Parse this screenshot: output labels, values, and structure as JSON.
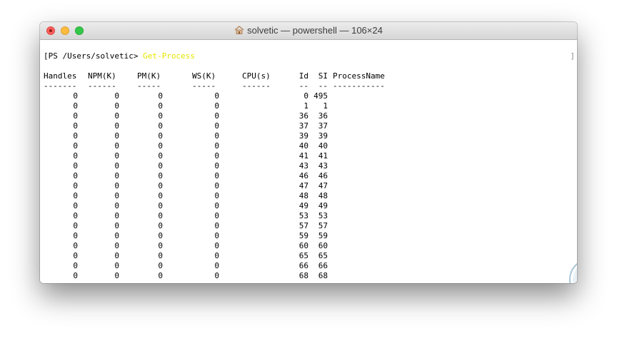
{
  "window": {
    "title": "solvetic — powershell — 106×24",
    "title_icon": "home-icon"
  },
  "terminal": {
    "prompt": "[PS /Users/solvetic> ",
    "command": "Get-Process",
    "right_bracket": "]",
    "command_color": "#e6e600",
    "headers": {
      "handles": "Handles",
      "npm": "NPM(K)",
      "pm": "PM(K)",
      "ws": "WS(K)",
      "cpu": "CPU(s)",
      "id": "Id",
      "si": "SI",
      "pn": "ProcessName"
    },
    "separators": {
      "handles": "-------",
      "npm": "------",
      "pm": "-----",
      "ws": "-----",
      "cpu": "------",
      "id": "--",
      "si": "--",
      "pn": "-----------"
    },
    "rows": [
      {
        "handles": "0",
        "npm": "0",
        "pm": "0",
        "ws": "0",
        "cpu": "",
        "id": "0",
        "si": "495",
        "pn": ""
      },
      {
        "handles": "0",
        "npm": "0",
        "pm": "0",
        "ws": "0",
        "cpu": "",
        "id": "1",
        "si": "1",
        "pn": ""
      },
      {
        "handles": "0",
        "npm": "0",
        "pm": "0",
        "ws": "0",
        "cpu": "",
        "id": "36",
        "si": "36",
        "pn": ""
      },
      {
        "handles": "0",
        "npm": "0",
        "pm": "0",
        "ws": "0",
        "cpu": "",
        "id": "37",
        "si": "37",
        "pn": ""
      },
      {
        "handles": "0",
        "npm": "0",
        "pm": "0",
        "ws": "0",
        "cpu": "",
        "id": "39",
        "si": "39",
        "pn": ""
      },
      {
        "handles": "0",
        "npm": "0",
        "pm": "0",
        "ws": "0",
        "cpu": "",
        "id": "40",
        "si": "40",
        "pn": ""
      },
      {
        "handles": "0",
        "npm": "0",
        "pm": "0",
        "ws": "0",
        "cpu": "",
        "id": "41",
        "si": "41",
        "pn": ""
      },
      {
        "handles": "0",
        "npm": "0",
        "pm": "0",
        "ws": "0",
        "cpu": "",
        "id": "43",
        "si": "43",
        "pn": ""
      },
      {
        "handles": "0",
        "npm": "0",
        "pm": "0",
        "ws": "0",
        "cpu": "",
        "id": "46",
        "si": "46",
        "pn": ""
      },
      {
        "handles": "0",
        "npm": "0",
        "pm": "0",
        "ws": "0",
        "cpu": "",
        "id": "47",
        "si": "47",
        "pn": ""
      },
      {
        "handles": "0",
        "npm": "0",
        "pm": "0",
        "ws": "0",
        "cpu": "",
        "id": "48",
        "si": "48",
        "pn": ""
      },
      {
        "handles": "0",
        "npm": "0",
        "pm": "0",
        "ws": "0",
        "cpu": "",
        "id": "49",
        "si": "49",
        "pn": ""
      },
      {
        "handles": "0",
        "npm": "0",
        "pm": "0",
        "ws": "0",
        "cpu": "",
        "id": "53",
        "si": "53",
        "pn": ""
      },
      {
        "handles": "0",
        "npm": "0",
        "pm": "0",
        "ws": "0",
        "cpu": "",
        "id": "57",
        "si": "57",
        "pn": ""
      },
      {
        "handles": "0",
        "npm": "0",
        "pm": "0",
        "ws": "0",
        "cpu": "",
        "id": "59",
        "si": "59",
        "pn": ""
      },
      {
        "handles": "0",
        "npm": "0",
        "pm": "0",
        "ws": "0",
        "cpu": "",
        "id": "60",
        "si": "60",
        "pn": ""
      },
      {
        "handles": "0",
        "npm": "0",
        "pm": "0",
        "ws": "0",
        "cpu": "",
        "id": "65",
        "si": "65",
        "pn": ""
      },
      {
        "handles": "0",
        "npm": "0",
        "pm": "0",
        "ws": "0",
        "cpu": "",
        "id": "66",
        "si": "66",
        "pn": ""
      },
      {
        "handles": "0",
        "npm": "0",
        "pm": "0",
        "ws": "0",
        "cpu": "",
        "id": "68",
        "si": "68",
        "pn": ""
      }
    ]
  },
  "watermark": {
    "icon": "solvetic-logo-icon",
    "color": "#a9c7d8"
  }
}
